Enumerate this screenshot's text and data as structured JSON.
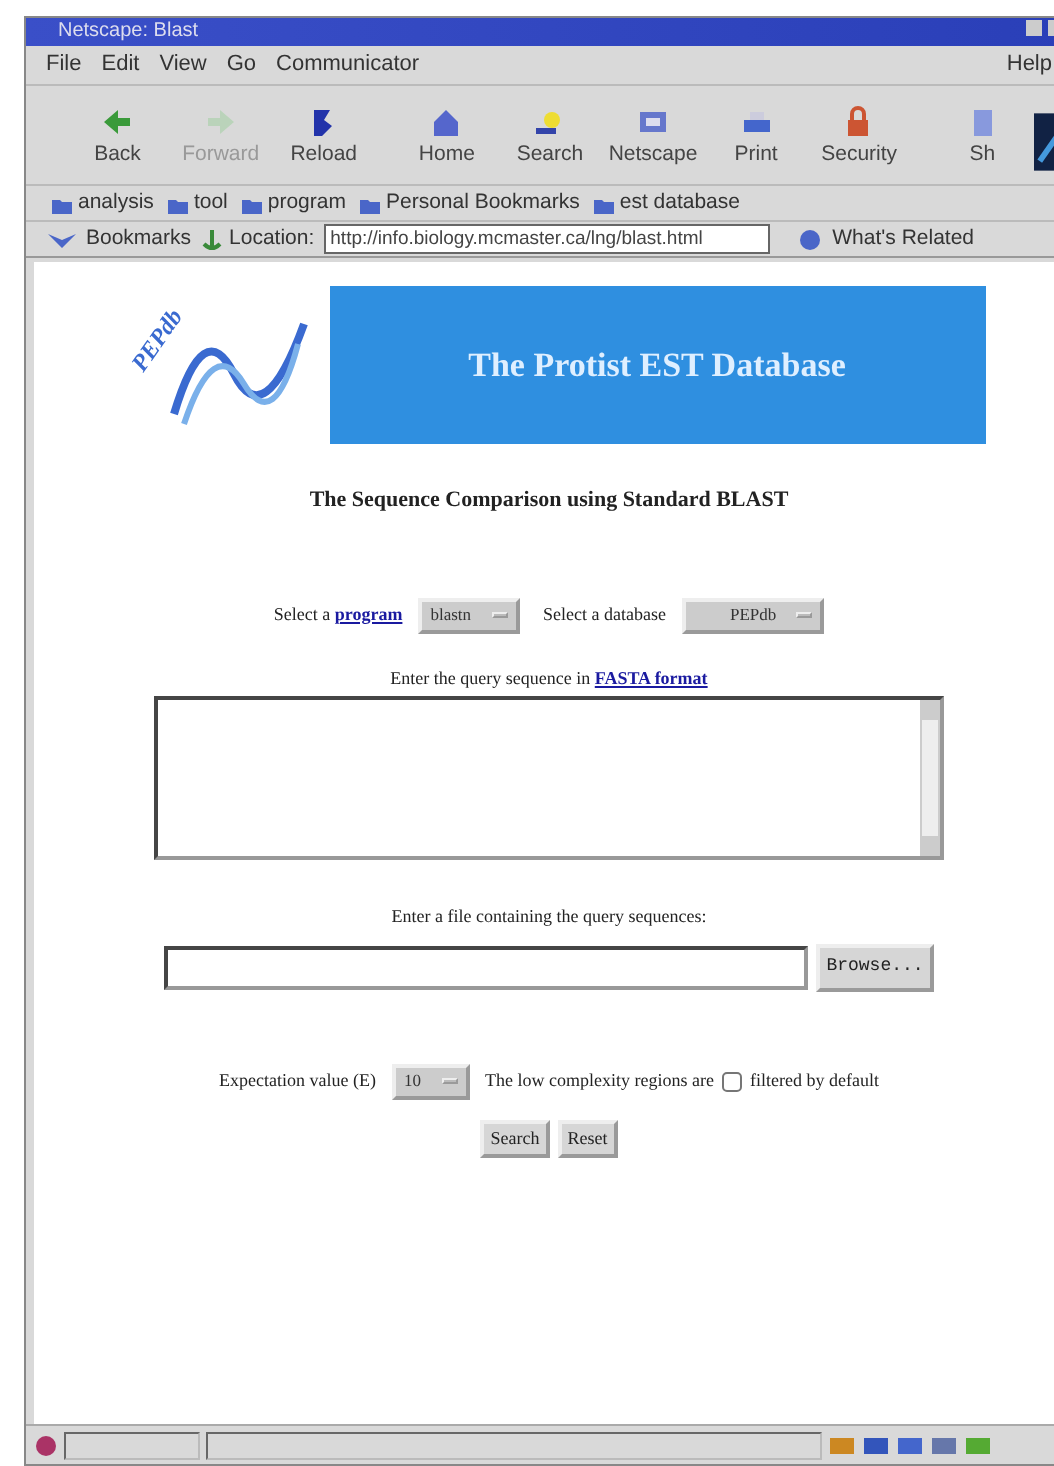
{
  "window": {
    "title": "Netscape: Blast"
  },
  "menu": {
    "items": [
      "File",
      "Edit",
      "View",
      "Go",
      "Communicator"
    ],
    "help": "Help"
  },
  "toolbar": [
    {
      "label": "Back",
      "disabled": false
    },
    {
      "label": "Forward",
      "disabled": true
    },
    {
      "label": "Reload",
      "disabled": false
    },
    {
      "label": "Home",
      "disabled": false
    },
    {
      "label": "Search",
      "disabled": false
    },
    {
      "label": "Netscape",
      "disabled": false
    },
    {
      "label": "Print",
      "disabled": false
    },
    {
      "label": "Security",
      "disabled": false
    },
    {
      "label": "Sh",
      "disabled": false
    }
  ],
  "bookmarks": [
    "analysis",
    "tool",
    "program",
    "Personal Bookmarks",
    "est database"
  ],
  "location_bar": {
    "bookmarks": "Bookmarks",
    "label": "Location:",
    "url": "http://info.biology.mcmaster.ca/lng/blast.html",
    "related": "What's Related"
  },
  "page": {
    "logo": "PEPdb",
    "banner": "The Protist EST Database",
    "heading": "The Sequence Comparison using Standard BLAST",
    "program_row": {
      "label": "Select a",
      "link": "program",
      "program": "blastn",
      "db_label": "Select a database",
      "database": "PEPdb"
    },
    "query": {
      "label": "Enter the query sequence in",
      "link": "FASTA format"
    },
    "file": {
      "label": "Enter a file containing the query sequences:",
      "browse": "Browse..."
    },
    "expect": {
      "label": "Expectation value (E)",
      "value": "10",
      "lowcomp": "The low complexity regions are",
      "filtered": false,
      "filter_label": "filtered by default"
    },
    "buttons": [
      "Search",
      "Reset"
    ]
  }
}
